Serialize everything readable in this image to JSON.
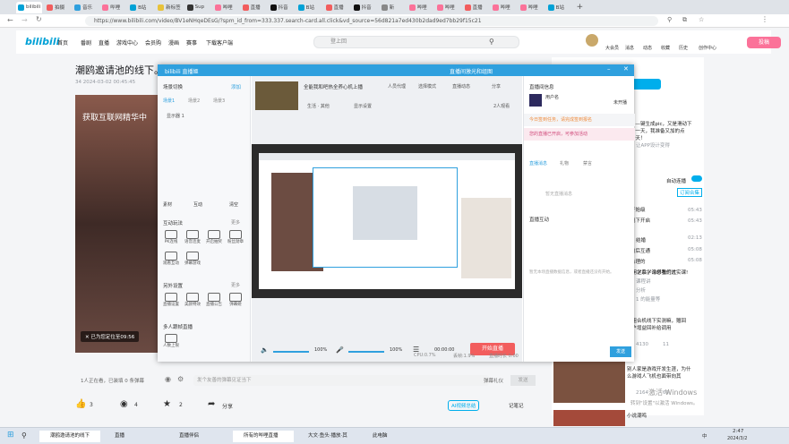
{
  "browser": {
    "url": "https://www.bilibili.com/video/BV1eNHqeDEsG/?spm_id_from=333.337.search-card.all.click&vd_source=56d821a7ed430b2dad9ed7bb29f15c21",
    "tabs": [
      "bilibili",
      "拍摄",
      "音乐",
      "哔哩",
      "B站",
      "新标签",
      "Sup",
      "哔哩",
      "直播",
      "抖音",
      "B站",
      "直播",
      "抖音",
      "新",
      "哔哩",
      "哔哩",
      "直播",
      "哔哩",
      "哔哩",
      "B站"
    ]
  },
  "site_header": {
    "logo": "bilibili",
    "nav": [
      "首页",
      "番剧",
      "直播",
      "游戏中心",
      "会员购",
      "漫画",
      "赛事",
      "下载客户端"
    ],
    "search_placeholder": "登上回",
    "icons": [
      "大会员",
      "消息",
      "动态",
      "收藏",
      "历史",
      "创作中心"
    ],
    "upload": "投稿"
  },
  "video": {
    "title": "潮鸥邀请池的线下。AA",
    "meta": "34   2024-03-02  00:45:45",
    "overlay": "获取互联网精华中",
    "cast_text": "已为您定位至09:56",
    "danmu_count": "1人正在看，已装填 0 条弹幕",
    "danmu_placeholder": "发个友善的弹幕见证当下",
    "danmu_etiquette": "弹幕礼仪",
    "danmu_send": "发送",
    "actions": {
      "like": "3",
      "coin": "4",
      "fav": "2",
      "share": "分享"
    },
    "ai_summary": "AI视频总结",
    "notes": "记笔记"
  },
  "right_panel": {
    "items": [
      "——键生成pic，又是滑动下",
      "好一天，我准备又加的点",
      "一天！",
      "让APP设计变得",
      "自动连播",
      "订阅合集",
      "开始级",
      "线下开启",
      "结婚",
      "前后互通",
      "合理的",
      "线下之后，谁想我们过",
      "如何学系学习必看的大实课!",
      "课程讲",
      "分析",
      "1 的能量等",
      "多组合机线下实测嘛，赠回",
      "客户增益回补给调用",
      "4130",
      "11",
      "别人家是游戏开发生涯，为什",
      "么游戏人飞机也面带向其",
      "2164",
      "69",
      "激活 Windows",
      "转到\"设置\"以激活 Windows。",
      "小说潮鸣"
    ],
    "durations": [
      "05:43",
      "05:43",
      "02:13",
      "05:08",
      "05:08"
    ]
  },
  "obs": {
    "title": "bilibili 直播姬",
    "title_right": "直播间激光和组图",
    "left": {
      "scene_header": "场景切换",
      "add_btn": "添加",
      "scene_tabs": [
        "场景1",
        "场景2",
        "场景3"
      ],
      "scene_item": "显示器 1",
      "source_bar": [
        "素材",
        "互动",
        "清空"
      ],
      "interact_header": "互动玩法",
      "more": "更多",
      "interact_items": [
        "PK连线",
        "语音连麦",
        "开启抽奖",
        "粉丝勋章",
        "观看互动",
        "弹幕游戏"
      ],
      "tools_header": "另外设置",
      "tools_items": [
        "直播设置",
        "美颜特效",
        "直播公告",
        "弹幕姬"
      ],
      "multi_header": "多人跟帧直播",
      "multi_item": "人数上限"
    },
    "center": {
      "room_title": "全能我和吧热全养心机上播",
      "tags": [
        "人员代理",
        "选择模式",
        "直播动态"
      ],
      "share": "分享",
      "area": "生活 · 其他",
      "audience": "2人观看",
      "layout": "显示设置",
      "volume1": "100%",
      "volume2": "100%",
      "timer": "00:00:00",
      "start_btn": "开始直播",
      "status": [
        "CPU:0.7%",
        "丢帧:1.9%",
        "直播时长 0:00"
      ]
    },
    "right": {
      "room_header": "直播间信息",
      "user": "用户名",
      "status": "未开播",
      "notice1": "今日签到任务，请完成签到报名",
      "notice2": "您的直播已开启，可参加活动",
      "tabs": [
        "直播消息",
        "礼物",
        "禁言"
      ],
      "chat_empty": "暂无直播消息",
      "panel2_header": "直播互动",
      "panel2_empty": "暂无本场直播数据信息，或者直播还没有开始。",
      "send": "发送"
    }
  },
  "taskbar": {
    "items": [
      "潮鸥邀请池的线下",
      "直播",
      "直播伴侣",
      "所有的哔哩直播",
      "大文·鱼头·播放·其",
      "此电脑"
    ],
    "time": "2:47",
    "date": "2024/3/2",
    "ime": "中"
  }
}
